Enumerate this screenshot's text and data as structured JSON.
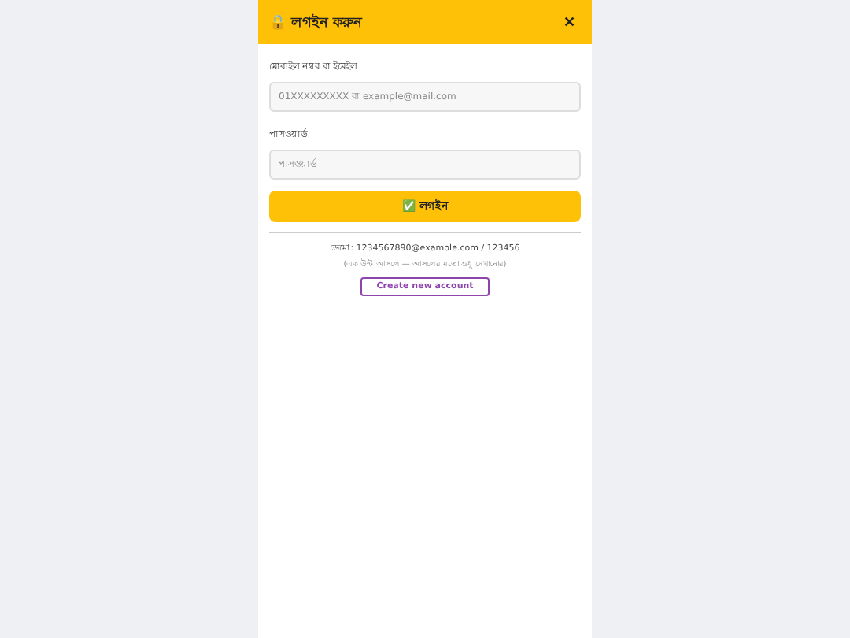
{
  "header": {
    "icon": "🔒",
    "title": "লগইন করুন",
    "close": "✕"
  },
  "fields": [
    {
      "label": "মোবাইল নম্বর বা ইমেইল",
      "placeholder": "01XXXXXXXXX বা example@mail.com"
    },
    {
      "label": "পাসওয়ার্ড",
      "placeholder": "পাসওয়ার্ড"
    }
  ],
  "submit": "✅ লগইন",
  "demo": "ডেমো: 1234567890@example.com / 123456",
  "note": "(একাউন্ট আসলে — আসলের মতো শুধু দেখানোর)",
  "create": "Create new account"
}
